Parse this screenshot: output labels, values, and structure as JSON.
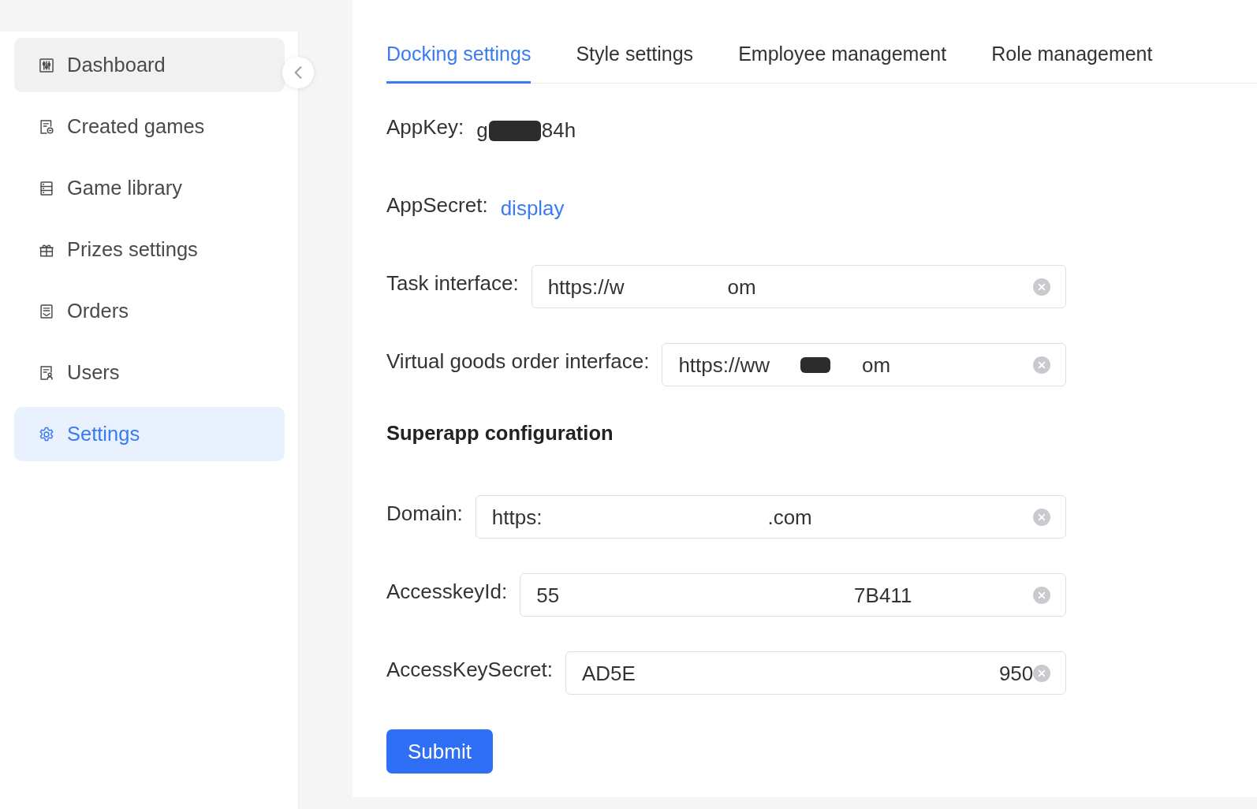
{
  "sidebar": {
    "items": [
      {
        "label": "Dashboard",
        "selected": false,
        "hovered": true
      },
      {
        "label": "Created games",
        "selected": false,
        "hovered": false
      },
      {
        "label": "Game library",
        "selected": false,
        "hovered": false
      },
      {
        "label": "Prizes settings",
        "selected": false,
        "hovered": false
      },
      {
        "label": "Orders",
        "selected": false,
        "hovered": false
      },
      {
        "label": "Users",
        "selected": false,
        "hovered": false
      },
      {
        "label": "Settings",
        "selected": true,
        "hovered": false
      }
    ]
  },
  "tabs": [
    {
      "label": "Docking settings",
      "selected": true
    },
    {
      "label": "Style settings",
      "selected": false
    },
    {
      "label": "Employee management",
      "selected": false
    },
    {
      "label": "Role management",
      "selected": false
    }
  ],
  "form": {
    "items": [
      {
        "kind": "text",
        "label": "AppKey:",
        "value_start": "g",
        "value_end": "84h",
        "masked": true
      },
      {
        "kind": "link",
        "label": "AppSecret:",
        "link": "display"
      },
      {
        "kind": "input",
        "label": "Task interface:",
        "value_start": "https://w",
        "value_end": "om",
        "clearable": true
      },
      {
        "kind": "input",
        "label": "Virtual goods order interface:",
        "value_start": "https://ww",
        "value_end": "om",
        "masked": true,
        "clearable": true
      },
      {
        "kind": "heading",
        "text": "Superapp configuration"
      },
      {
        "kind": "input",
        "label": "Domain:",
        "value_start": "https:",
        "value_end": ".com",
        "clearable": true
      },
      {
        "kind": "input",
        "label": "AccesskeyId:",
        "value_start": "55",
        "value_end": "7B411",
        "clearable": true
      },
      {
        "kind": "input",
        "label": "AccessKeySecret:",
        "value_start": "AD5E",
        "value_end": "950",
        "clearable": true
      }
    ],
    "submit_button": "Submit"
  }
}
